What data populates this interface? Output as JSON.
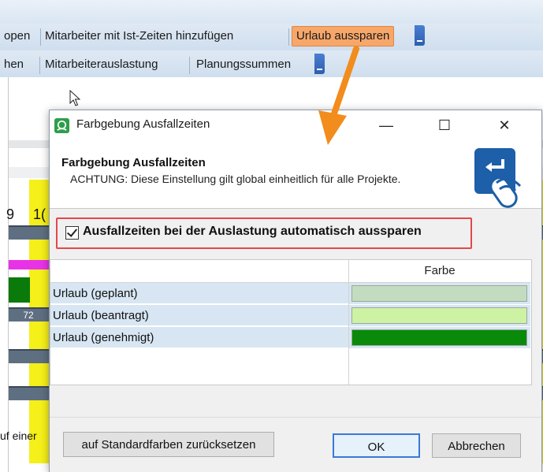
{
  "toolbar_row1": {
    "item_a": "open",
    "item_b": "Mitarbeiter mit Ist-Zeiten hinzufügen",
    "item_c": "Urlaub aussparen"
  },
  "toolbar_row2": {
    "item_a": "hen",
    "item_b": "Mitarbeiterauslastung",
    "item_c": "Planungssummen"
  },
  "timeline": {
    "n1": "9",
    "n2": "1("
  },
  "grid": {
    "bar_value": "72",
    "left_clip_text": "uf einer"
  },
  "dialog": {
    "title": "Farbgebung Ausfallzeiten",
    "header_title": "Farbgebung Ausfallzeiten",
    "header_subtitle": "ACHTUNG: Diese Einstellung gilt global einheitlich für alle Projekte.",
    "checkbox_label": "Ausfallzeiten bei der Auslastung automatisch aussparen",
    "checkbox_checked": true,
    "table": {
      "col_color": "Farbe",
      "rows": [
        {
          "label": "Urlaub (geplant)",
          "color": "#c3dcc0"
        },
        {
          "label": "Urlaub (beantragt)",
          "color": "#cdf2a4"
        },
        {
          "label": "Urlaub (genehmigt)",
          "color": "#0a8a0a"
        }
      ]
    },
    "buttons": {
      "reset": "auf Standardfarben zurücksetzen",
      "ok": "OK",
      "cancel": "Abbrechen"
    },
    "window_controls": {
      "minimize": "—",
      "maximize": "☐",
      "close": "✕"
    }
  },
  "colors": {
    "highlight_button": "#f7a76a",
    "annotation_arrow": "#f28c1c",
    "annotation_box": "#e4474d",
    "row_bg": "#d7e6f2"
  }
}
